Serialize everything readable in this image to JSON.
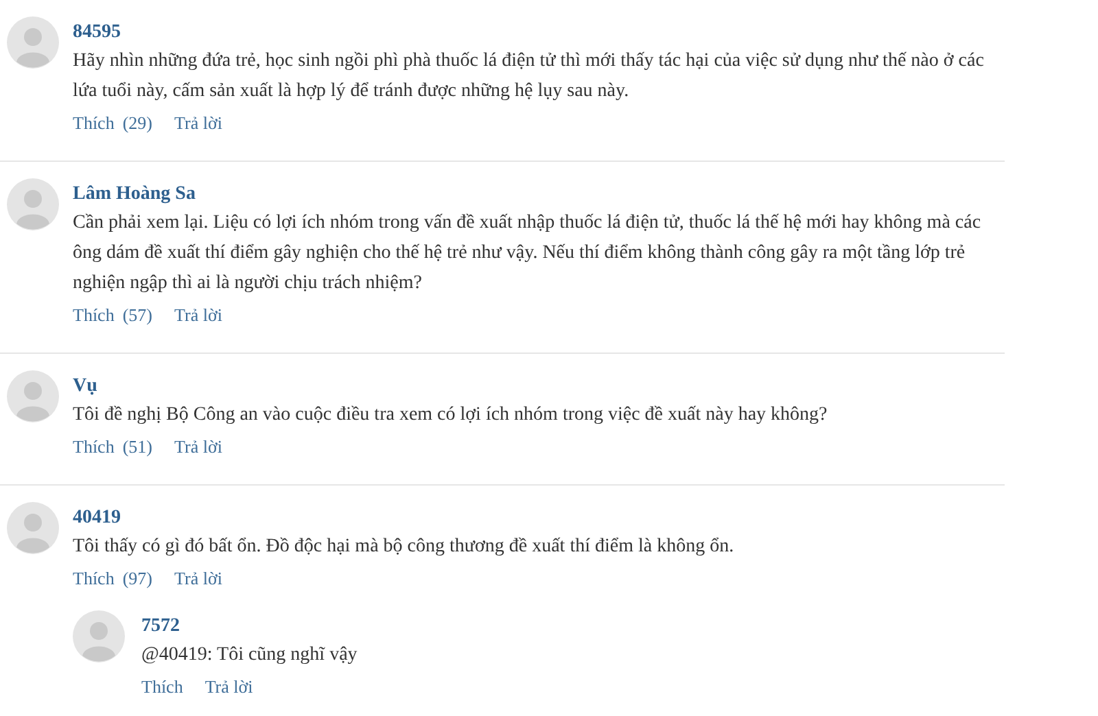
{
  "comments": [
    {
      "author": "84595",
      "text": "Hãy nhìn những đứa trẻ, học sinh ngồi phì phà thuốc lá điện tử thì mới thấy tác hại của việc sử dụng như thế nào ở các lứa tuổi này, cấm sản xuất là hợp lý để tránh được những hệ lụy sau này.",
      "like": "Thích",
      "like_count": "(29)",
      "reply": "Trả lời"
    },
    {
      "author": "Lâm Hoàng Sa",
      "text": "Cần phải xem lại. Liệu có lợi ích nhóm trong vấn đề xuất nhập thuốc lá điện tử, thuốc lá thế hệ mới hay không mà các ông dám đề xuất thí điểm gây nghiện cho thế hệ trẻ như vậy. Nếu thí điểm không thành công gây ra một tầng lớp trẻ nghiện ngập thì ai là người chịu trách nhiệm?",
      "like": "Thích",
      "like_count": "(57)",
      "reply": "Trả lời"
    },
    {
      "author": "Vụ",
      "text": "Tôi đề nghị Bộ Công an vào cuộc điều tra xem có lợi ích nhóm trong việc đề xuất này hay không?",
      "like": "Thích",
      "like_count": "(51)",
      "reply": "Trả lời"
    },
    {
      "author": "40419",
      "text": "Tôi thấy có gì đó bất ổn. Đồ độc hại mà bộ công thương đề xuất thí điểm là không ổn.",
      "like": "Thích",
      "like_count": "(97)",
      "reply": "Trả lời",
      "children": [
        {
          "author": "7572",
          "text": "@40419: Tôi cũng nghĩ vậy",
          "like": "Thích",
          "reply": "Trả lời"
        }
      ]
    }
  ]
}
